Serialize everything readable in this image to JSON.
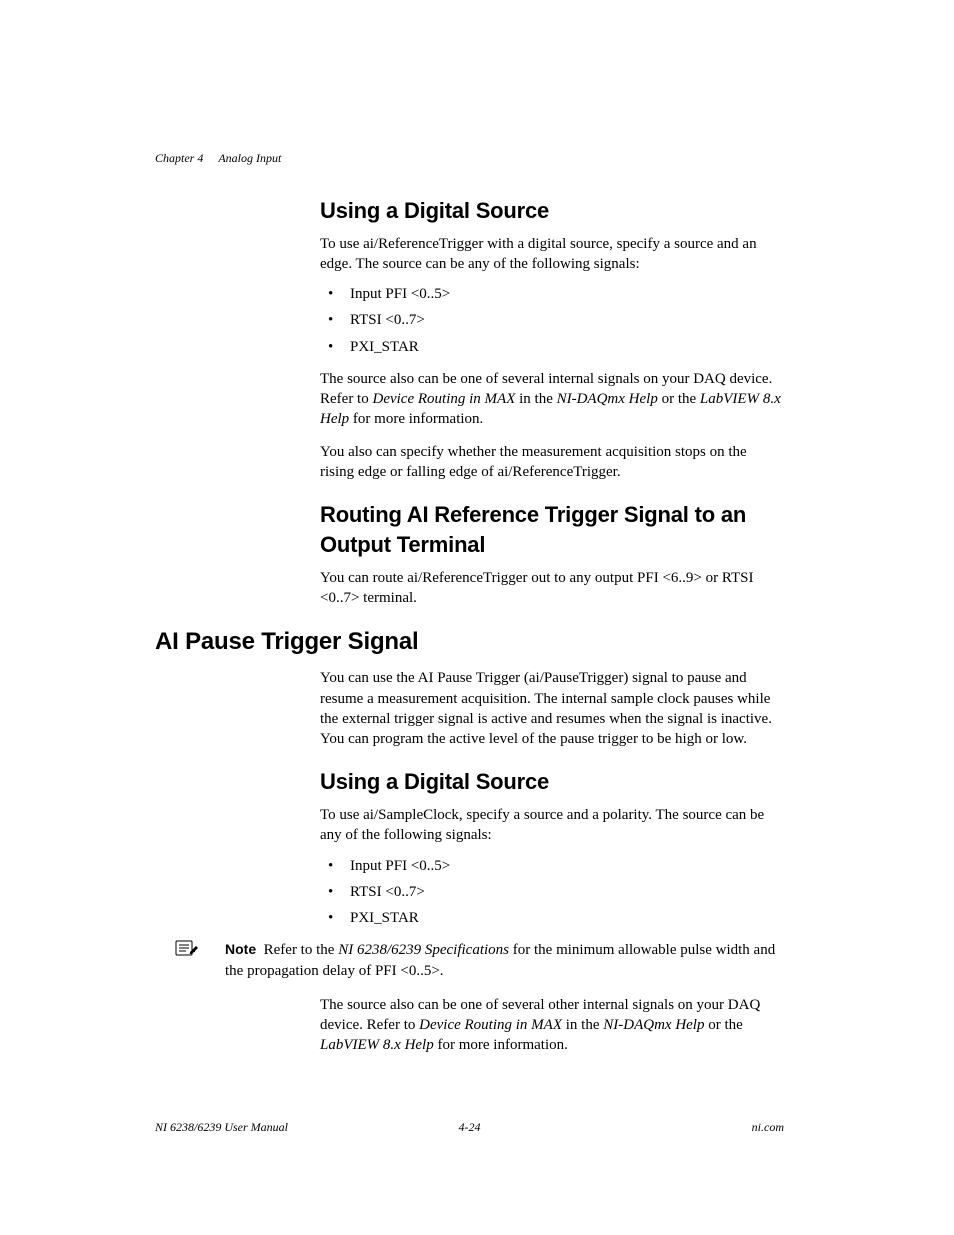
{
  "header": {
    "chapter_label": "Chapter 4",
    "chapter_title": "Analog Input"
  },
  "section1": {
    "heading": "Using a Digital Source",
    "intro": "To use ai/ReferenceTrigger with a digital source, specify a source and an edge. The source can be any of the following signals:",
    "bullets": [
      "Input PFI <0..5>",
      "RTSI <0..7>",
      "PXI_STAR"
    ],
    "p2_pre": "The source also can be one of several internal signals on your DAQ device. Refer to ",
    "p2_i1": "Device Routing in MAX",
    "p2_mid1": " in the ",
    "p2_i2": "NI-DAQmx Help",
    "p2_mid2": " or the ",
    "p2_i3": "LabVIEW 8.x Help",
    "p2_post": " for more information.",
    "p3": "You also can specify whether the measurement acquisition stops on the rising edge or falling edge of ai/ReferenceTrigger."
  },
  "section2": {
    "heading": "Routing AI Reference Trigger Signal to an Output Terminal",
    "p1": "You can route ai/ReferenceTrigger out to any output PFI <6..9> or RTSI <0..7> terminal."
  },
  "section3": {
    "heading": "AI Pause Trigger Signal",
    "p1": "You can use the AI Pause Trigger (ai/PauseTrigger) signal to pause and resume a measurement acquisition. The internal sample clock pauses while the external trigger signal is active and resumes when the signal is inactive. You can program the active level of the pause trigger to be high or low."
  },
  "section4": {
    "heading": "Using a Digital Source",
    "intro": "To use ai/SampleClock, specify a source and a polarity. The source can be any of the following signals:",
    "bullets": [
      "Input PFI <0..5>",
      "RTSI <0..7>",
      "PXI_STAR"
    ]
  },
  "note": {
    "label": "Note",
    "pre": "Refer to the ",
    "i1": "NI 6238/6239 Specifications",
    "post": " for the minimum allowable pulse width and the propagation delay of PFI <0..5>."
  },
  "section5": {
    "p1_pre": "The source also can be one of several other internal signals on your DAQ device. Refer to ",
    "p1_i1": "Device Routing in MAX",
    "p1_mid1": " in the ",
    "p1_i2": "NI-DAQmx Help",
    "p1_mid2": " or the ",
    "p1_i3": "LabVIEW 8.x Help",
    "p1_post": " for more information."
  },
  "footer": {
    "left": "NI 6238/6239 User Manual",
    "center": "4-24",
    "right": "ni.com"
  }
}
